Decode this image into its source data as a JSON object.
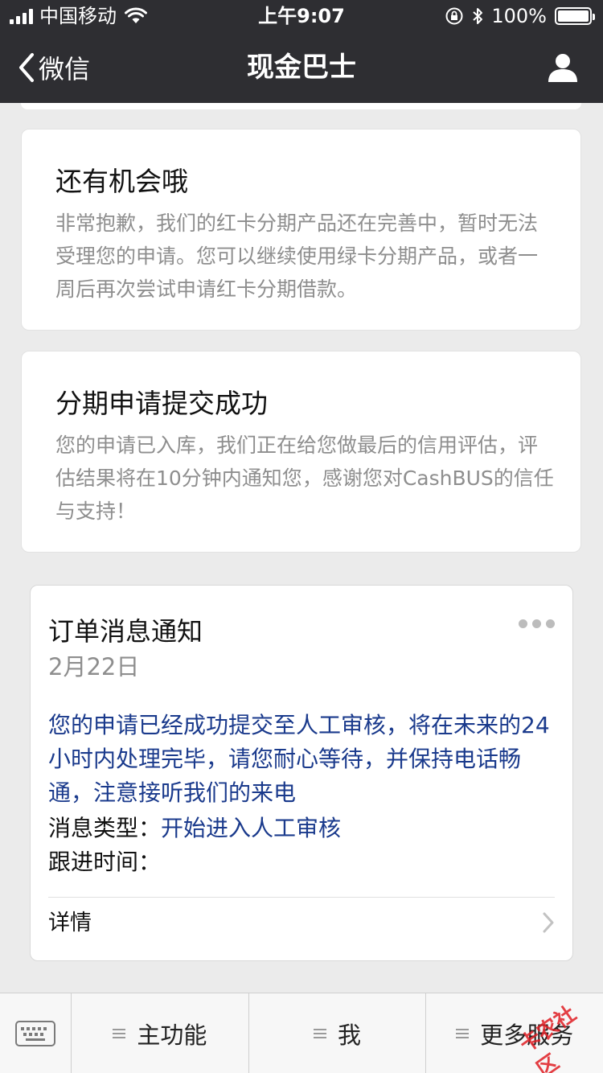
{
  "status_bar": {
    "carrier": "中国移动",
    "time": "上午9:07",
    "battery": "100%",
    "battery_level": 100
  },
  "nav": {
    "back_label": "微信",
    "title": "现金巴士"
  },
  "cards": [
    {
      "title": "还有机会哦",
      "body": "非常抱歉，我们的红卡分期产品还在完善中，暂时无法受理您的申请。您可以继续使用绿卡分期产品，或者一周后再次尝试申请红卡分期借款。"
    },
    {
      "title": "分期申请提交成功",
      "body": "您的申请已入库，我们正在给您做最后的信用评估，评估结果将在10分钟内通知您，感谢您对CashBUS的信任与支持！"
    }
  ],
  "template": {
    "title": "订单消息通知",
    "date": "2月22日",
    "message": "您的申请已经成功提交至人工审核，将在未来的24小时内处理完毕，请您耐心等待，并保持电话畅通，注意接听我们的来电",
    "type_label": "消息类型：",
    "type_value": "开始进入人工审核",
    "followup_label": "跟进时间：",
    "detail_label": "详情"
  },
  "bottom_menu": {
    "items": [
      {
        "label": "主功能"
      },
      {
        "label": "我"
      },
      {
        "label": "更多服务"
      }
    ]
  },
  "watermark": "卡农社区",
  "colors": {
    "nav_bg": "#2e2e32",
    "link_blue": "#1a3a8c",
    "muted": "#8e8e8e",
    "watermark_red": "#e01e24"
  }
}
